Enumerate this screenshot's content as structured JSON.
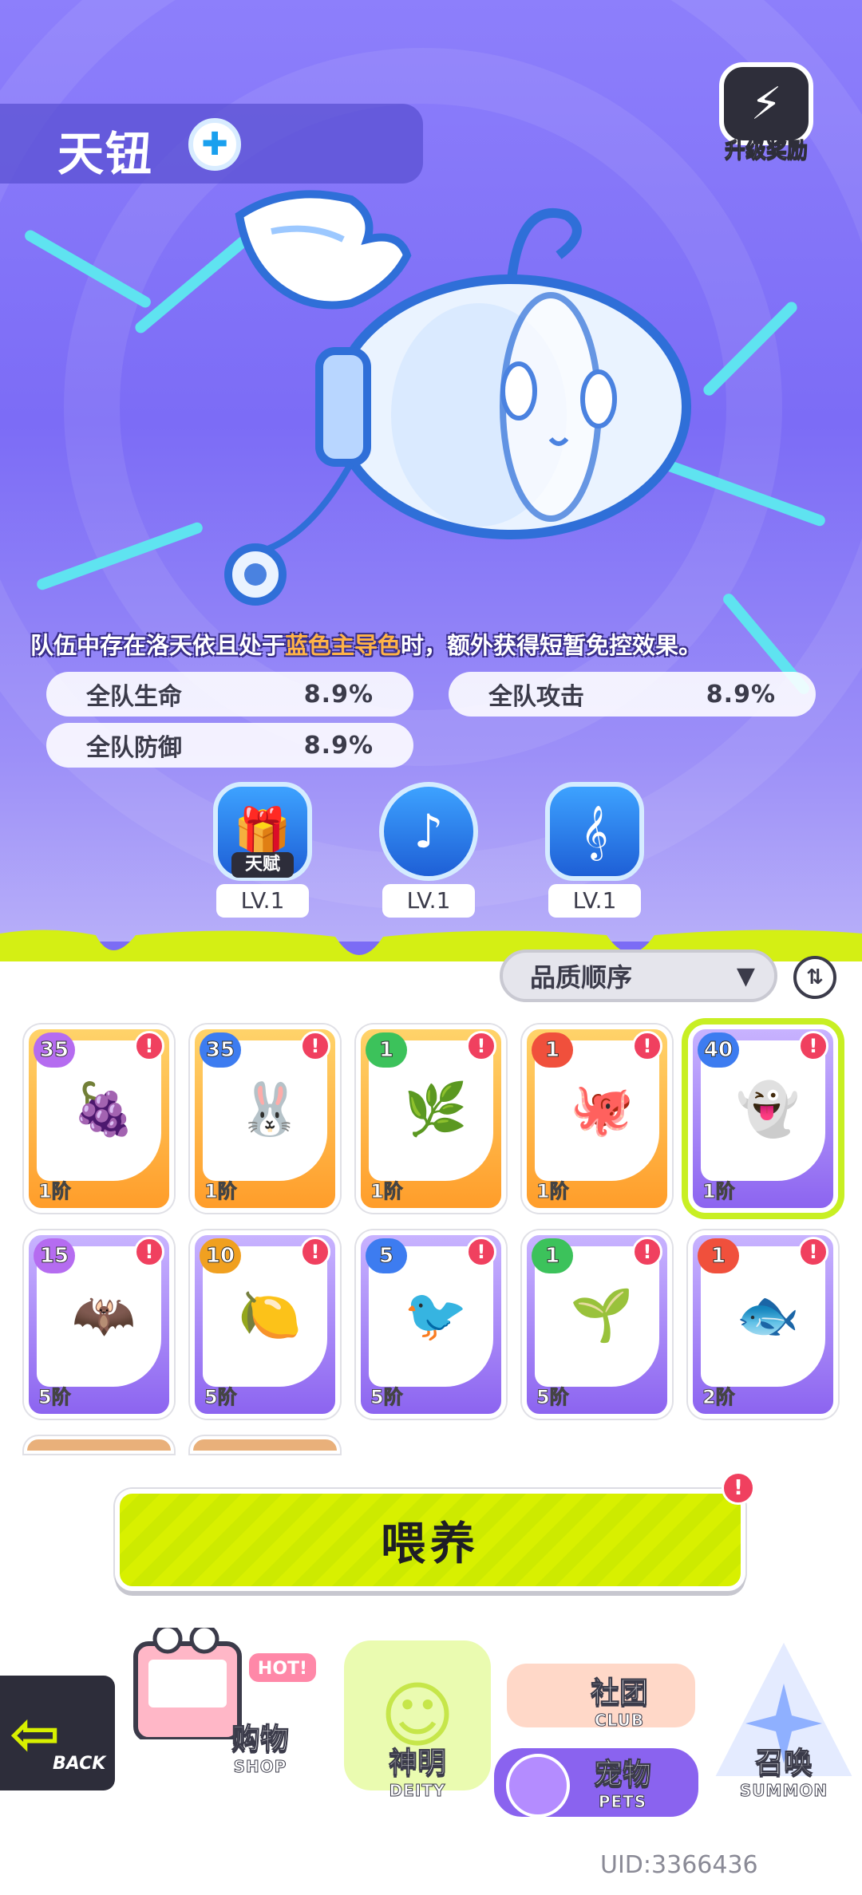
{
  "pet": {
    "name": "天钮",
    "element_icon": "cross-element-icon"
  },
  "reward_button": {
    "label": "升级奖励",
    "icon": "upgrade-reward-icon"
  },
  "skill": {
    "prefix": "队伍中存在洛天依且处于",
    "highlight": "蓝色主导色",
    "suffix": "时，额外获得短暂免控效果。"
  },
  "stats": [
    {
      "label": "全队生命",
      "value": "8.9%"
    },
    {
      "label": "全队攻击",
      "value": "8.9%"
    },
    {
      "label": "全队防御",
      "value": "8.9%"
    }
  ],
  "talents": [
    {
      "icon": "talent-gift-icon",
      "tag": "天赋",
      "level": "LV.1"
    },
    {
      "icon": "music-note-icon",
      "level": "LV.1"
    },
    {
      "icon": "treble-clef-icon",
      "level": "LV.1"
    }
  ],
  "sort": {
    "label": "品质顺序",
    "toggle_icon": "sort-toggle-icon"
  },
  "pets_grid": [
    {
      "level": "35",
      "tier": "1阶",
      "frame": "orange",
      "badge_color": "#b56cf0",
      "art": "grape-pet-icon",
      "alert": "!"
    },
    {
      "level": "35",
      "tier": "1阶",
      "frame": "orange",
      "badge_color": "#3d7cf0",
      "art": "bunny-pet-icon",
      "alert": "!"
    },
    {
      "level": "1",
      "tier": "1阶",
      "frame": "orange",
      "badge_color": "#3cc25b",
      "art": "leaf-pet-icon",
      "alert": "!"
    },
    {
      "level": "1",
      "tier": "1阶",
      "frame": "orange",
      "badge_color": "#f0503c",
      "art": "octopus-pet-icon",
      "alert": "!"
    },
    {
      "level": "40",
      "tier": "1阶",
      "frame": "purple",
      "badge_color": "#3d7cf0",
      "art": "tianniu-pet-icon",
      "alert": "!",
      "selected": true
    },
    {
      "level": "15",
      "tier": "5阶",
      "frame": "purple",
      "badge_color": "#b56cf0",
      "art": "bat-pet-icon",
      "alert": "!"
    },
    {
      "level": "10",
      "tier": "5阶",
      "frame": "purple",
      "badge_color": "#f0a020",
      "art": "lemon-pet-icon",
      "alert": "!"
    },
    {
      "level": "5",
      "tier": "5阶",
      "frame": "purple",
      "badge_color": "#3d7cf0",
      "art": "bird-pet-icon",
      "alert": "!"
    },
    {
      "level": "1",
      "tier": "5阶",
      "frame": "purple",
      "badge_color": "#3cc25b",
      "art": "sprout-pet-icon",
      "alert": "!"
    },
    {
      "level": "1",
      "tier": "2阶",
      "frame": "purple",
      "badge_color": "#f0503c",
      "art": "piranha-pet-icon",
      "alert": "!"
    }
  ],
  "feed_button": {
    "label": "喂养",
    "alert": "!"
  },
  "nav": {
    "back": {
      "label": "BACK"
    },
    "shop": {
      "title": "购物",
      "sub": "SHOP",
      "hot": "HOT!"
    },
    "deity": {
      "title": "神明",
      "sub": "DEITY"
    },
    "club": {
      "title": "社团",
      "sub": "CLUB"
    },
    "pets": {
      "title": "宠物",
      "sub": "PETS"
    },
    "summon": {
      "title": "召唤",
      "sub": "SUMMON"
    }
  },
  "uid": "UID:3366436"
}
